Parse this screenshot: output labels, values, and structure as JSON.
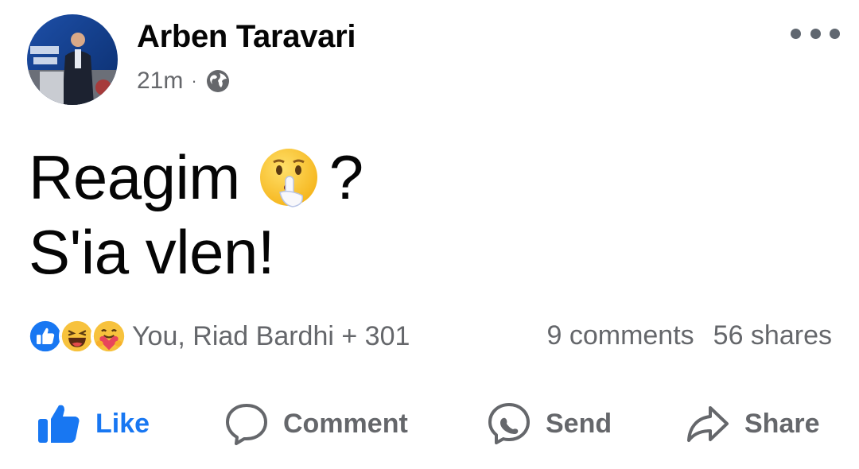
{
  "post": {
    "author": "Arben Taravari",
    "time": "21m",
    "separator": "·",
    "audience_icon": "globe-icon",
    "text_line1": "Reagim",
    "text_line1_suffix": "?",
    "text_line2": "S'ia vlen!",
    "inline_emoji": "shushing-face-icon"
  },
  "reactions": {
    "icons": [
      "like-reaction-icon",
      "haha-reaction-icon",
      "care-reaction-icon"
    ],
    "summary": "You, Riad Bardhi + 301"
  },
  "stats": {
    "comments": "9 comments",
    "shares": "56 shares"
  },
  "actions": {
    "like": "Like",
    "comment": "Comment",
    "send": "Send",
    "share": "Share"
  },
  "colors": {
    "accent": "#1877f2",
    "secondary_text": "#65676b",
    "primary_text": "#050505"
  }
}
